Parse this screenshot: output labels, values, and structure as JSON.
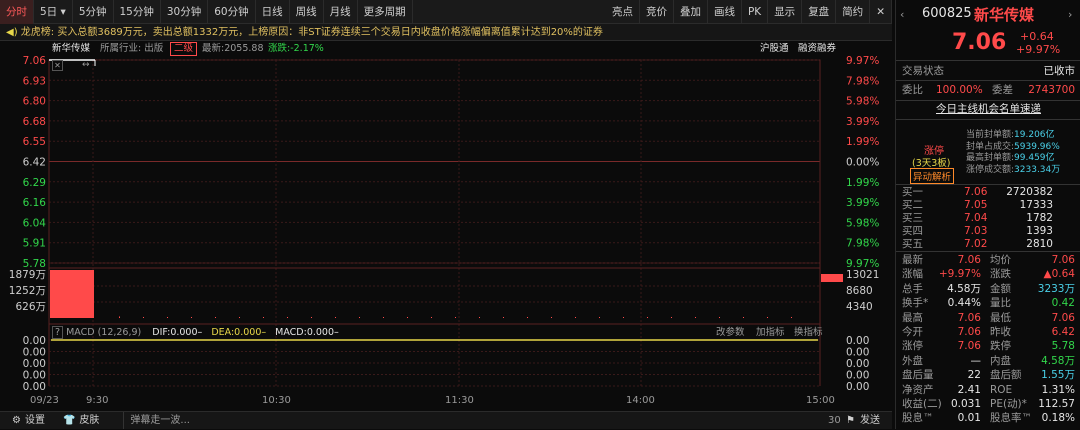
{
  "toolbar": {
    "left_items": [
      "分时",
      "5日",
      "5分钟",
      "15分钟",
      "30分钟",
      "60分钟",
      "日线",
      "周线",
      "月线",
      "更多周期"
    ],
    "right_items": [
      "亮点",
      "竞价",
      "叠加",
      "画线",
      "PK",
      "显示",
      "复盘",
      "简约"
    ],
    "close_glyph": "✕",
    "five_day_arrow": "▾"
  },
  "dragon": {
    "label": "龙虎榜:",
    "text": "买入总额3689万元，卖出总额1332万元，上榜原因：非ST证券连续三个交易日内收盘价格涨幅偏离值累计达到20%的证券"
  },
  "infoline": {
    "name": "新华传媒",
    "industry": "所属行业: 出版",
    "tag": "二级",
    "latest": "最新:2055.88",
    "change": "涨跌:-2.17%",
    "links": [
      "沪股通",
      "融资融券"
    ]
  },
  "price_axis": {
    "left": [
      "7.06",
      "6.93",
      "6.80",
      "6.68",
      "6.55",
      "6.42",
      "6.29",
      "6.16",
      "6.04",
      "5.91",
      "5.78"
    ],
    "right": [
      "9.97%",
      "7.98%",
      "5.98%",
      "3.99%",
      "1.99%",
      "0.00%",
      "1.99%",
      "3.99%",
      "5.98%",
      "7.98%",
      "9.97%"
    ]
  },
  "volume_axis": {
    "left": [
      "1879万",
      "1252万",
      "626万"
    ],
    "right": [
      "13021",
      "8680",
      "4340"
    ]
  },
  "macd": {
    "label": "MACD (12,26,9)",
    "dif": "DIF:0.000–",
    "dea": "DEA:0.000–",
    "macd": "MACD:0.000–",
    "actions": [
      "改参数",
      "加指标",
      "换指标"
    ],
    "left": [
      "0.00",
      "0.00",
      "0.00",
      "0.00",
      "0.00"
    ],
    "right": [
      "0.00",
      "0.00",
      "0.00",
      "0.00",
      "0.00"
    ]
  },
  "time_axis": {
    "date": "09/23",
    "ticks": [
      "9:30",
      "10:30",
      "11:30",
      "14:00",
      "15:00"
    ]
  },
  "bottom": {
    "settings": "设置",
    "skin": "皮肤",
    "barrage": "弹幕走一波...",
    "count": "30",
    "send": "发送"
  },
  "quote": {
    "code": "600825",
    "name": "新华传媒",
    "price": "7.06",
    "change": "+0.64",
    "pct": "+9.97%",
    "status_label": "交易状态",
    "status_value": "已收市",
    "ratio_label": "委比",
    "ratio_value": "100.00%",
    "diff_label": "委差",
    "diff_value": "2743700",
    "top_link": "今日主线机会名单速递",
    "limit_label": "涨停",
    "limit_sub": "(3天3板)",
    "analysis": "异动解析",
    "seal": [
      {
        "label": "当前封单额:",
        "value": "19.206亿"
      },
      {
        "label": "封单占成交:",
        "value": "5939.96%"
      },
      {
        "label": "最高封单额:",
        "value": "99.459亿"
      },
      {
        "label": "涨停成交额:",
        "value": "3233.34万"
      }
    ],
    "bids": [
      {
        "label": "买一",
        "price": "7.06",
        "vol": "2720382"
      },
      {
        "label": "买二",
        "price": "7.05",
        "vol": "17333"
      },
      {
        "label": "买三",
        "price": "7.04",
        "vol": "1782"
      },
      {
        "label": "买四",
        "price": "7.03",
        "vol": "1393"
      },
      {
        "label": "买五",
        "price": "7.02",
        "vol": "2810"
      }
    ],
    "stats": [
      {
        "l1": "最新",
        "v1": "7.06",
        "l2": "均价",
        "v2": "7.06"
      },
      {
        "l1": "涨幅",
        "v1": "+9.97%",
        "l2": "涨跌",
        "v2": "▲0.64"
      },
      {
        "l1": "总手",
        "v1": "4.58万",
        "l2": "金额",
        "v2": "3233万"
      },
      {
        "l1": "换手*",
        "v1": "0.44%",
        "l2": "量比",
        "v2": "0.42"
      },
      {
        "l1": "最高",
        "v1": "7.06",
        "l2": "最低",
        "v2": "7.06"
      },
      {
        "l1": "今开",
        "v1": "7.06",
        "l2": "昨收",
        "v2": "6.42"
      },
      {
        "l1": "涨停",
        "v1": "7.06",
        "l2": "跌停",
        "v2": "5.78"
      },
      {
        "l1": "外盘",
        "v1": "—",
        "l2": "内盘",
        "v2": "4.58万"
      },
      {
        "l1": "盘后量",
        "v1": "22",
        "l2": "盘后额",
        "v2": "1.55万"
      },
      {
        "l1": "净资产",
        "v1": "2.41",
        "l2": "ROE",
        "v2": "1.31%"
      },
      {
        "l1": "收益(二)",
        "v1": "0.031",
        "l2": "PE(动)*",
        "v2": "112.57"
      },
      {
        "l1": "股息™",
        "v1": "0.01",
        "l2": "股息率™",
        "v2": "0.18%"
      }
    ]
  },
  "series": {
    "price": 7.06,
    "volume_bars": [
      1879,
      60,
      40,
      30,
      22,
      18,
      15,
      12,
      20,
      14,
      10,
      16,
      12,
      8,
      14,
      10,
      12,
      9,
      11,
      8,
      10,
      9,
      8,
      12,
      10,
      7,
      9,
      8,
      11,
      10
    ]
  },
  "colors": {
    "up": "#ff4a4a",
    "down": "#32d74b",
    "accent": "#e8d84a",
    "grid": "#3a1a1a"
  }
}
